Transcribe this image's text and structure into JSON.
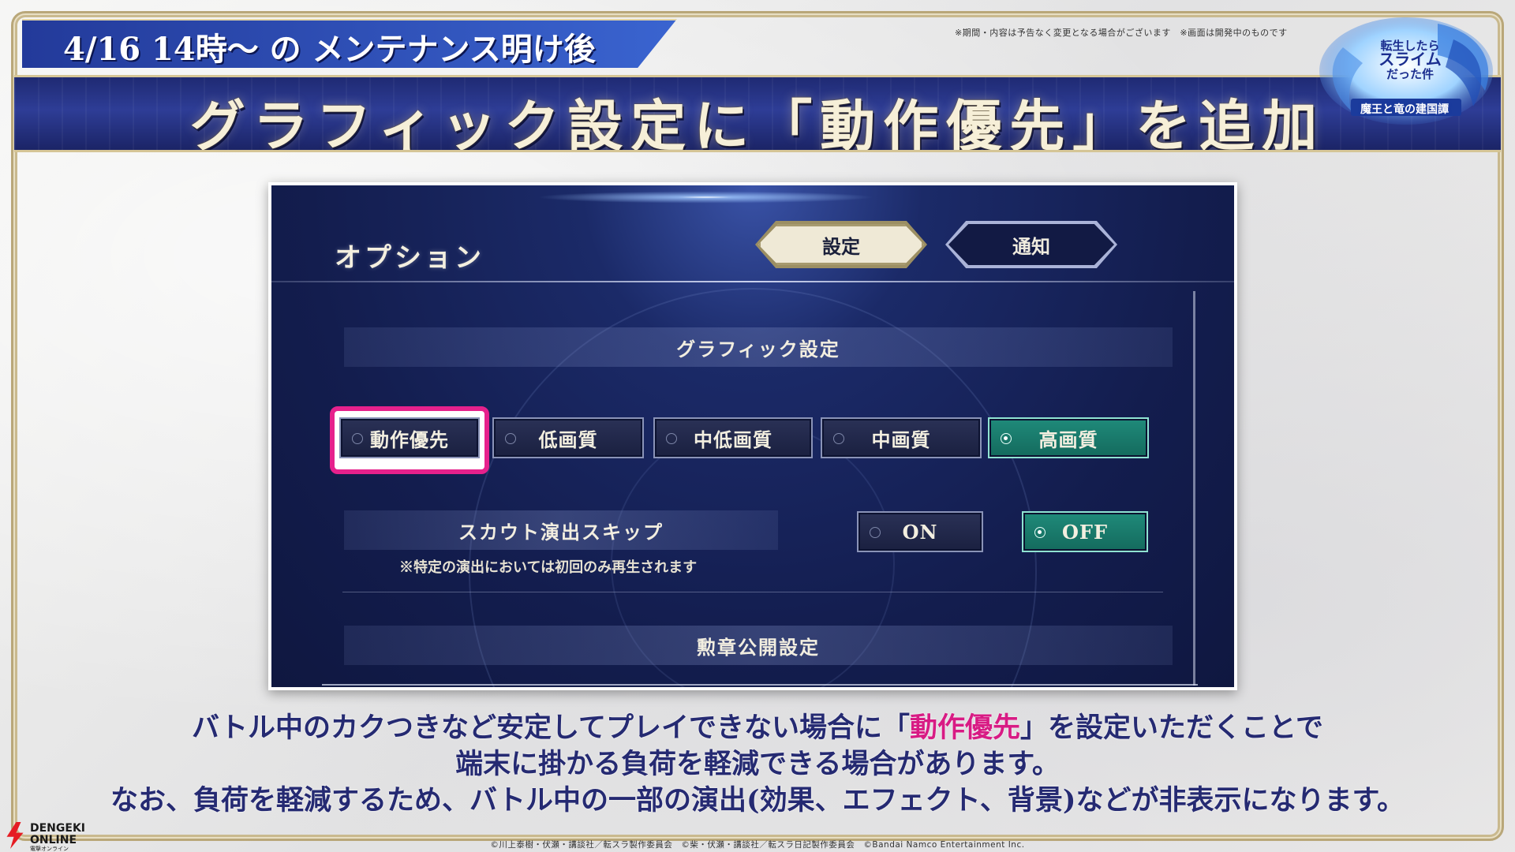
{
  "banner": {
    "tag": "4/16 14時〜 の メンテナンス明け後",
    "title": "グラフィック設定に「動作優先」を追加",
    "disclaimer": "※期間・内容は予告なく変更となる場合がございます　※画面は開発中のものです"
  },
  "game_logo": {
    "line1": "転生したら",
    "line2": "スライム",
    "line3": "だった件",
    "subtitle": "魔王と竜の建国譚"
  },
  "screen": {
    "title": "オプション",
    "tabs": [
      {
        "label": "設定",
        "active": true
      },
      {
        "label": "通知",
        "active": false
      }
    ],
    "graphics_section": "グラフィック設定",
    "graphics_options": [
      {
        "label": "動作優先",
        "selected": false
      },
      {
        "label": "低画質",
        "selected": false
      },
      {
        "label": "中低画質",
        "selected": false
      },
      {
        "label": "中画質",
        "selected": false
      },
      {
        "label": "高画質",
        "selected": true
      }
    ],
    "scout_section": "スカウト演出スキップ",
    "scout_note": "※特定の演出においては初回のみ再生されます",
    "scout_options": [
      {
        "label": "ON",
        "selected": false
      },
      {
        "label": "OFF",
        "selected": true
      }
    ],
    "medal_section": "勲章公開設定"
  },
  "description": {
    "line1_pre": "バトル中のカクつきなど安定してプレイできない場合に「",
    "line1_em": "動作優先",
    "line1_post": "」を設定いただくことで",
    "line2": "端末に掛かる負荷を軽減できる場合があります。",
    "line3": "なお、負荷を軽減するため、バトル中の一部の演出(効果、エフェクト、背景)などが非表示になります。"
  },
  "copyright": "©川上泰樹・伏瀬・講談社／転スラ製作委員会　©柴・伏瀬・講談社／転スラ日記製作委員会　©Bandai Namco Entertainment Inc.",
  "brand": {
    "line1": "DENGEKI",
    "line2": "ONLINE",
    "line3": "電撃オンライン"
  },
  "colors": {
    "highlight": "#e6218c",
    "emphasis_text": "#d81b84",
    "selected_button": "#1f8a7a",
    "header_band": "#2e3d96"
  }
}
